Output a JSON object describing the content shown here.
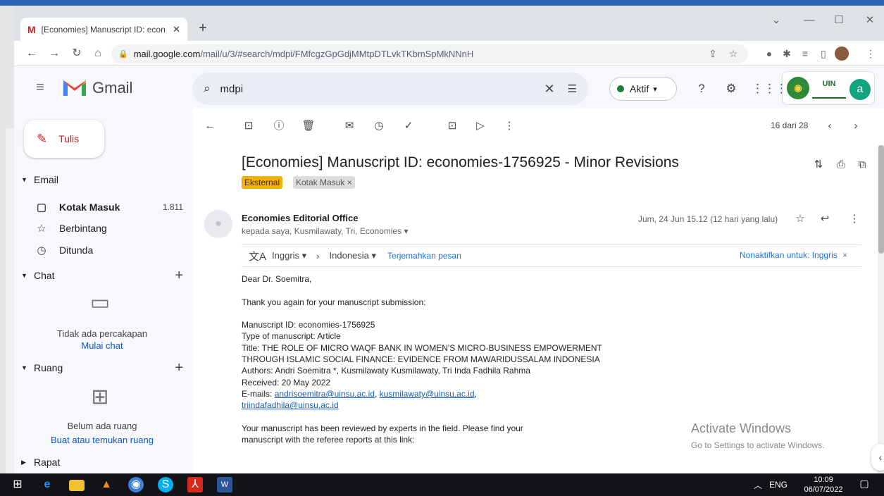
{
  "browser": {
    "tab_title": "[Economies] Manuscript ID: econ",
    "tab_close": "✕",
    "new_tab": "+",
    "url_domain": "mail.google.com",
    "url_path": "/mail/u/3/#search/mdpi/FMfcgzGpGdjMMtpDTLvkTKbmSpMkNNnH",
    "window_controls": [
      "⌄",
      "—",
      "☐",
      "✕"
    ]
  },
  "gmail": {
    "brand": "Gmail",
    "search_value": "mdpi",
    "status": "Aktif",
    "status_caret": "▾",
    "uin_label": "UIN",
    "avatar_letter": "a"
  },
  "sidebar": {
    "compose": "Tulis",
    "email_header": "Email",
    "items": [
      {
        "label": "Kotak Masuk",
        "count": "1.811",
        "icon": "inbox-icon"
      },
      {
        "label": "Berbintang",
        "count": "",
        "icon": "star-icon"
      },
      {
        "label": "Ditunda",
        "count": "",
        "icon": "clock-icon"
      }
    ],
    "chat_header": "Chat",
    "chat_empty": "Tidak ada percakapan",
    "chat_link": "Mulai chat",
    "rooms_header": "Ruang",
    "rooms_empty": "Belum ada ruang",
    "rooms_link": "Buat atau temukan ruang",
    "meet_header": "Rapat"
  },
  "toolbar": {
    "pager": "16 dari 28"
  },
  "email": {
    "subject": "[Economies] Manuscript ID: economies-1756925 - Minor Revisions",
    "labels": [
      "Eksternal",
      "Kotak Masuk ×"
    ],
    "sender": "Economies Editorial Office",
    "recipients": "kepada saya, Kusmilawaty, Tri, Economies ▾",
    "date": "Jum, 24 Jun 15.12 (12 hari yang lalu)",
    "translate": {
      "from": "Inggris ▾",
      "to": "Indonesia ▾",
      "link": "Terjemahkan pesan",
      "disable": "Nonaktifkan untuk: Inggris"
    },
    "greeting": "Dear Dr. Soemitra,",
    "thanks": "Thank you again for your manuscript submission:",
    "manuscript_id": "Manuscript ID: economies-1756925",
    "type": "Type of manuscript: Article",
    "title1": "Title: THE ROLE OF MICRO WAQF BANK IN WOMEN'S MICRO-BUSINESS EMPOWERMENT",
    "title2": "THROUGH ISLAMIC SOCIAL FINANCE: EVIDENCE FROM MAWARIDUSSALAM INDONESIA",
    "authors": "Authors: Andri Soemitra *, Kusmilawaty Kusmilawaty, Tri Inda Fadhila Rahma",
    "received": "Received: 20 May 2022",
    "emails_label": "E-mails:",
    "email1": "andrisoemitra@uinsu.ac.id",
    "email2": "kusmilawaty@uinsu.ac.id",
    "email3": "triindafadhila@uinsu.ac.id",
    "review1": "Your manuscript has been reviewed by experts in the field. Please find your",
    "review2": "manuscript with the referee reports at this link:"
  },
  "watermark": {
    "line1": "Activate Windows",
    "line2": "Go to Settings to activate Windows."
  },
  "taskbar": {
    "lang": "ENG",
    "time": "10:09",
    "date": "06/07/2022"
  }
}
